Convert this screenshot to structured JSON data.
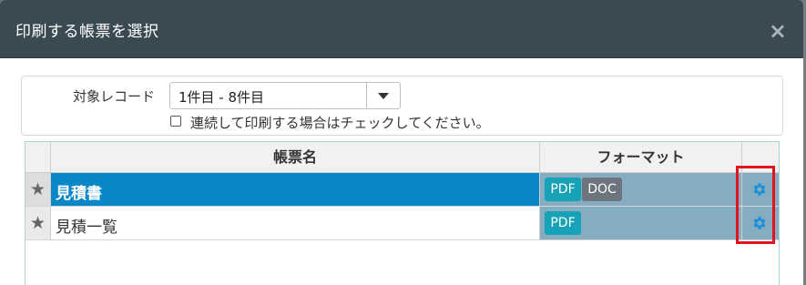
{
  "dialog": {
    "title": "印刷する帳票を選択",
    "close_symbol": "×"
  },
  "options": {
    "target_label": "対象レコード",
    "range_selected": "1件目 - 8件目",
    "continuous_print_label": "連続して印刷する場合はチェックしてください。",
    "continuous_print_checked": false
  },
  "table": {
    "headers": {
      "name": "帳票名",
      "format": "フォーマット"
    },
    "rows": [
      {
        "name": "見積書",
        "favorite_icon": "star-icon",
        "formats": [
          "PDF",
          "DOC"
        ],
        "settings_icon": "gear-icon",
        "selected": true
      },
      {
        "name": "見積一覧",
        "favorite_icon": "star-icon",
        "formats": [
          "PDF"
        ],
        "settings_icon": "gear-icon",
        "selected": false
      }
    ]
  },
  "colors": {
    "titlebar": "#394a52",
    "selected_row": "#0b86c6",
    "format_cell": "#86adbf",
    "pdf_button": "#17a2b8",
    "doc_button": "#6c757d",
    "gear": "#1a8fdc",
    "highlight_box": "#e0141e"
  }
}
